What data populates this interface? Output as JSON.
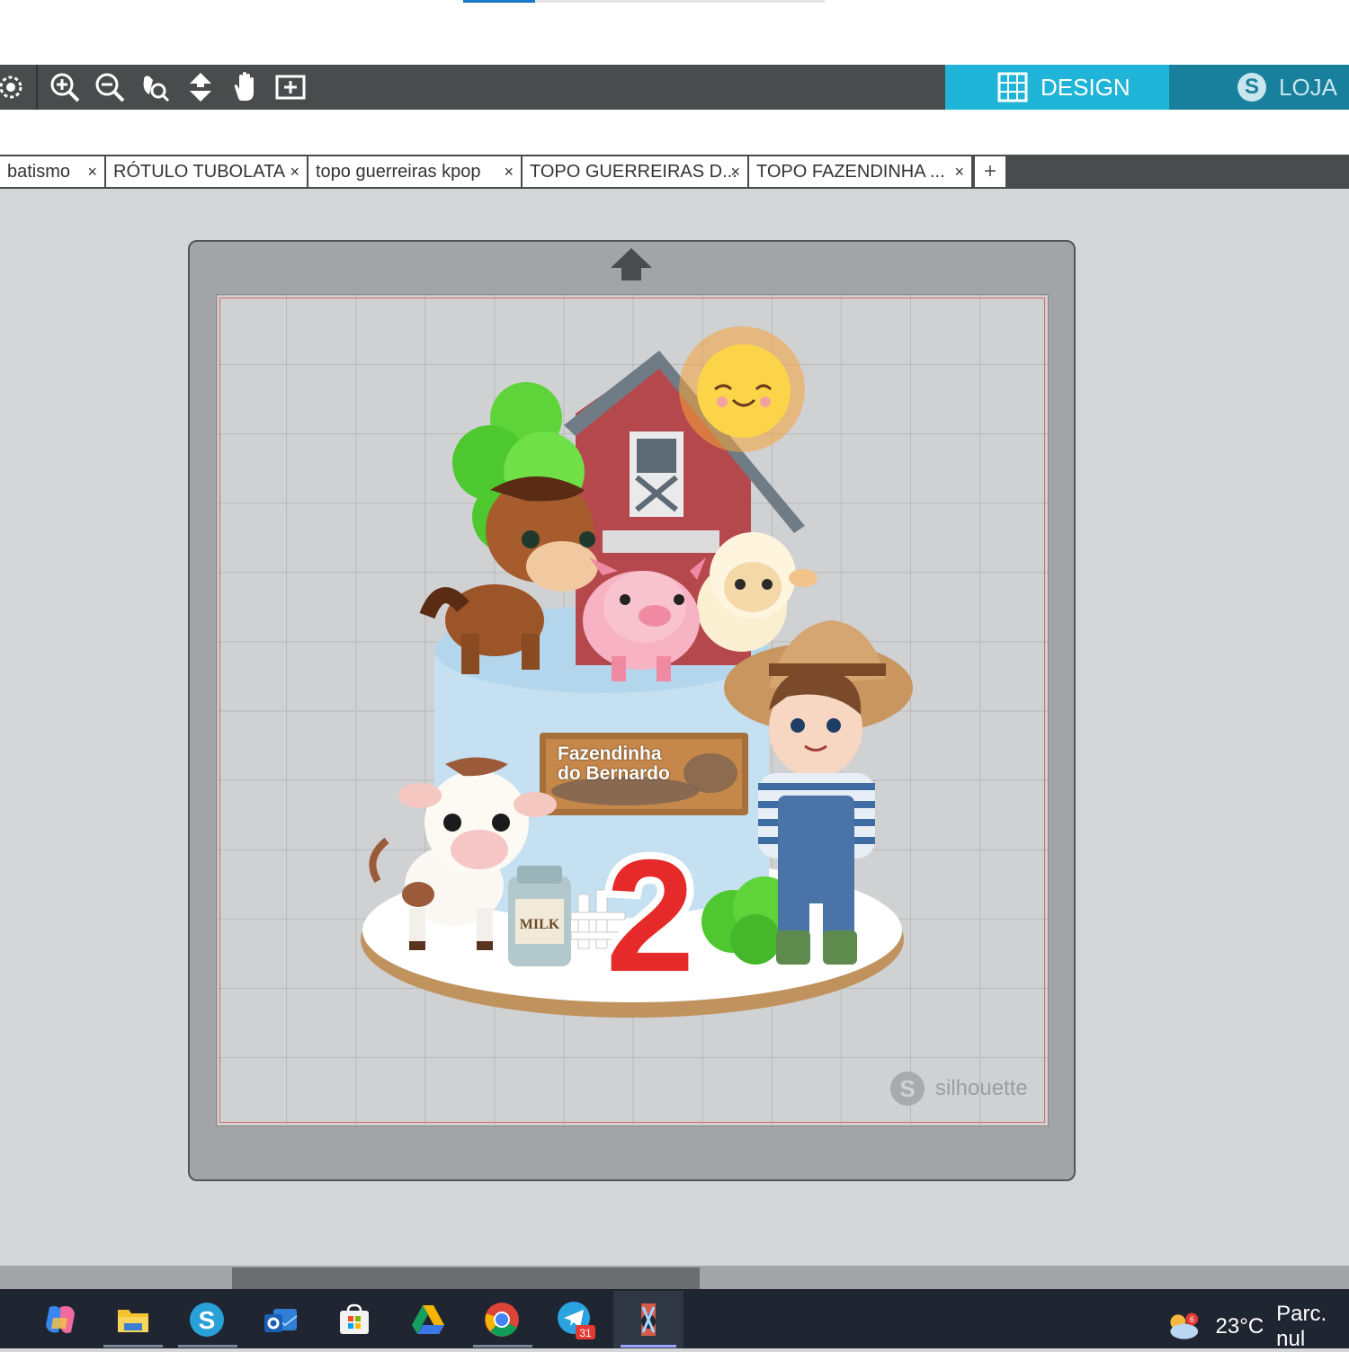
{
  "toolbar": {
    "tools": [
      "select-icon",
      "zoom-in-icon",
      "zoom-out-icon",
      "zoom-selection-icon",
      "move-down-icon",
      "pan-hand-icon",
      "fit-to-page-icon"
    ],
    "design_label": "DESIGN",
    "store_label": "LOJA"
  },
  "tabs": [
    {
      "label": "batismo",
      "close": "×"
    },
    {
      "label": "RÓTULO TUBOLATA",
      "close": "×"
    },
    {
      "label": "topo guerreiras kpop",
      "close": "×"
    },
    {
      "label": "TOPO GUERREIRAS D...",
      "close": "×"
    },
    {
      "label": "TOPO FAZENDINHA ...",
      "close": "×"
    }
  ],
  "tab_add": "+",
  "canvas": {
    "sign_line1": "Fazendinha",
    "sign_line2": "do Bernardo",
    "number": "2",
    "milk_label": "MILK",
    "watermark": "silhouette",
    "watermark_logo": "S"
  },
  "taskbar": {
    "apps": [
      "copilot-icon",
      "file-explorer-icon",
      "silhouette-studio-icon",
      "outlook-icon",
      "microsoft-store-icon",
      "google-drive-icon",
      "chrome-icon",
      "telegram-icon",
      "snipping-tool-icon"
    ],
    "telegram_badge": "31",
    "weather_badge": "6",
    "temperature": "23°C",
    "weather_text": "Parc. nul"
  },
  "colors": {
    "design_accent": "#1fb4d8",
    "store_accent": "#18809d",
    "toolbar_bg": "#4a4b4c",
    "cut_border": "#e06464"
  }
}
